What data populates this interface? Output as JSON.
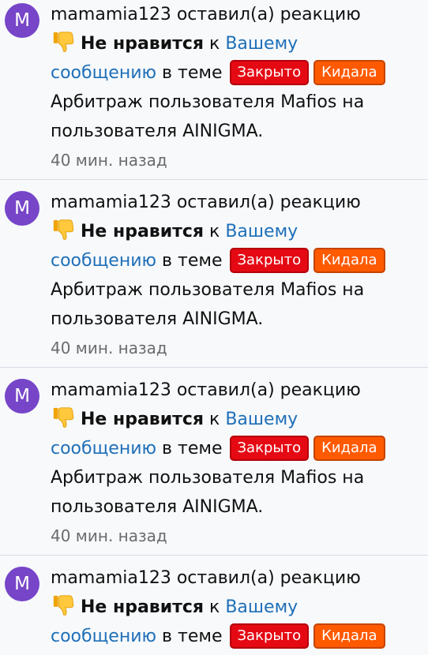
{
  "notifications": [
    {
      "avatar_letter": "M",
      "avatar_color": "#7645c8",
      "username": "mamamia123",
      "action": "оставил(а) реакцию",
      "reaction_icon": "thumbs-down-icon",
      "reaction": "Не нравится",
      "prep": "к",
      "link_part1": "Вашему",
      "link_part2": "сообщению",
      "in_topic": "в теме",
      "tag_closed": "Закрыто",
      "tag_scam": "Кидала",
      "topic_line1": "Арбитраж пользователя Mafios на",
      "topic_line2": "пользователя AINIGMA.",
      "time": "40 мин. назад"
    },
    {
      "avatar_letter": "M",
      "avatar_color": "#7645c8",
      "username": "mamamia123",
      "action": "оставил(а) реакцию",
      "reaction_icon": "thumbs-down-icon",
      "reaction": "Не нравится",
      "prep": "к",
      "link_part1": "Вашему",
      "link_part2": "сообщению",
      "in_topic": "в теме",
      "tag_closed": "Закрыто",
      "tag_scam": "Кидала",
      "topic_line1": "Арбитраж пользователя Mafios на",
      "topic_line2": "пользователя AINIGMA.",
      "time": "40 мин. назад"
    },
    {
      "avatar_letter": "M",
      "avatar_color": "#7645c8",
      "username": "mamamia123",
      "action": "оставил(а) реакцию",
      "reaction_icon": "thumbs-down-icon",
      "reaction": "Не нравится",
      "prep": "к",
      "link_part1": "Вашему",
      "link_part2": "сообщению",
      "in_topic": "в теме",
      "tag_closed": "Закрыто",
      "tag_scam": "Кидала",
      "topic_line1": "Арбитраж пользователя Mafios на",
      "topic_line2": "пользователя AINIGMA.",
      "time": "40 мин. назад"
    },
    {
      "avatar_letter": "M",
      "avatar_color": "#7645c8",
      "username": "mamamia123",
      "action": "оставил(а) реакцию",
      "reaction_icon": "thumbs-down-icon",
      "reaction": "Не нравится",
      "prep": "к",
      "link_part1": "Вашему",
      "link_part2": "сообщению",
      "in_topic": "в теме",
      "tag_closed": "Закрыто",
      "tag_scam": "Кидала"
    }
  ]
}
